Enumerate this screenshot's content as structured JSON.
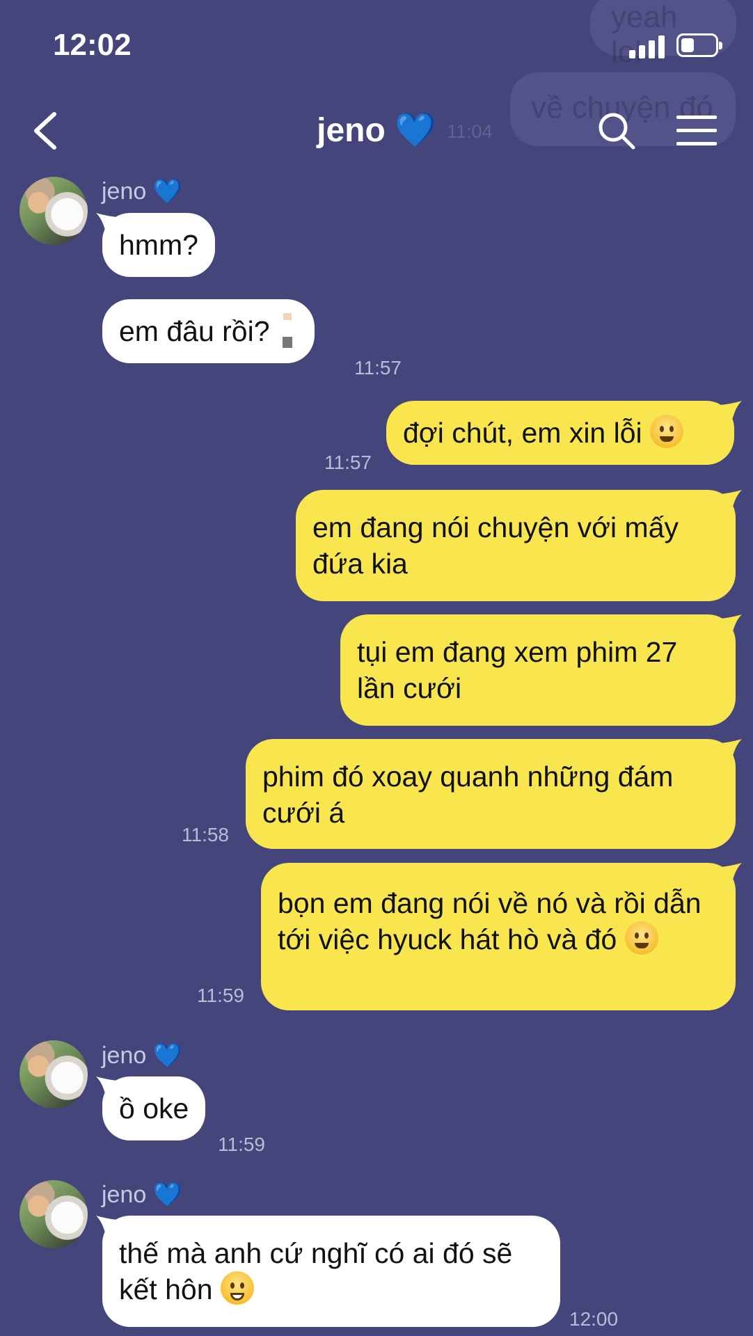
{
  "status_bar": {
    "time": "12:02"
  },
  "background_ghost": {
    "texts": [
      "yeah lol",
      "về chuyện đó"
    ],
    "time": "11:04"
  },
  "header": {
    "title": "jeno 💙"
  },
  "messages": [
    {
      "sender": "jeno 💙",
      "text": "hmm?"
    },
    {
      "text": "em đâu rồi?",
      "time": "11:57"
    },
    {
      "text": "đợi chút, em xin lỗi",
      "time": "11:57"
    },
    {
      "text": "em đang nói chuyện với mấy đứa kia"
    },
    {
      "text": "tụi em đang xem phim 27 lần cưới"
    },
    {
      "text": "phim đó xoay quanh những đám cưới á",
      "time": "11:58"
    },
    {
      "text": "bọn em đang nói về nó và rồi dẫn tới việc hyuck hát hò và đó",
      "time": "11:59"
    },
    {
      "sender": "jeno 💙",
      "text": "ồ oke",
      "time": "11:59"
    },
    {
      "sender": "jeno 💙",
      "text": "thế mà anh cứ nghĩ có ai đó sẽ kết hôn",
      "time": "12:00"
    }
  ],
  "icons": [
    "back-chevron-icon",
    "search-icon",
    "menu-icon",
    "signal-icon",
    "battery-icon",
    "person-standing-emoji",
    "sneezing-face-emoji",
    "woozy-face-emoji",
    "grinning-face-emoji"
  ],
  "colors": {
    "background": "#44457a",
    "incoming_bubble": "#ffffff",
    "outgoing_bubble": "#f9e64f"
  }
}
